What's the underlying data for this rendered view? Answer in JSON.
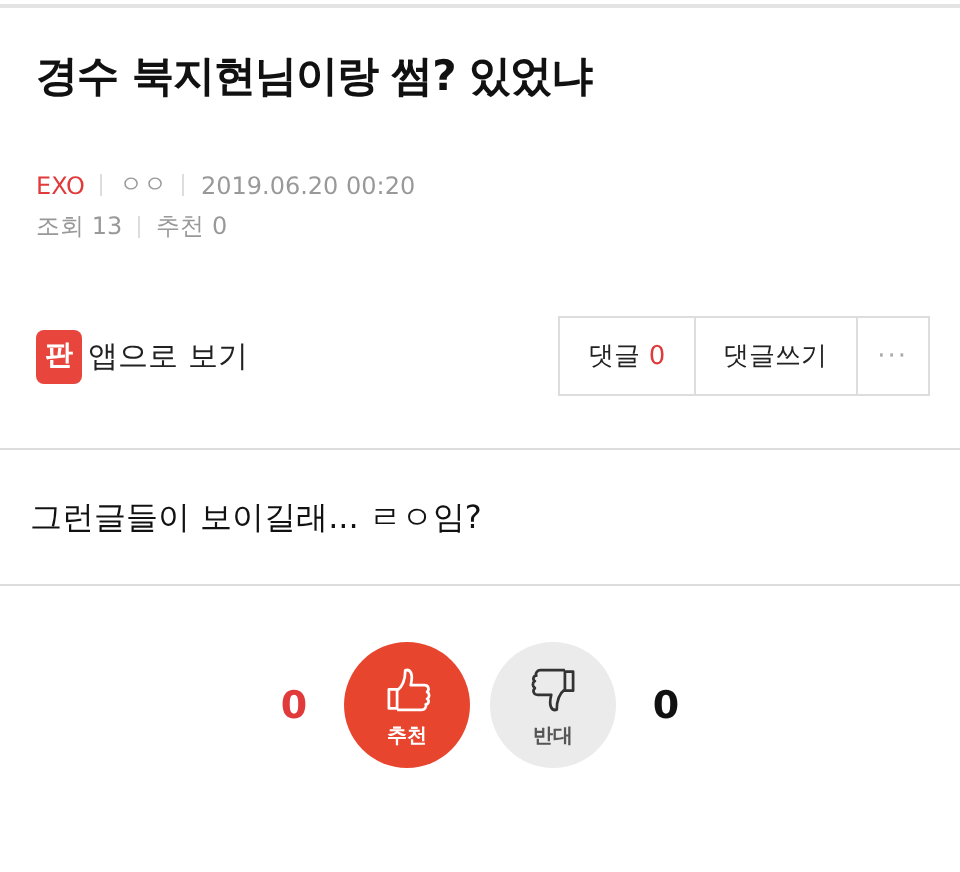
{
  "post": {
    "title": "경수 북지현님이랑 썸? 있었냐",
    "meta": [
      {
        "kind": "category",
        "text": "EXO"
      },
      {
        "kind": "author",
        "text": "ㅇㅇ"
      },
      {
        "kind": "date",
        "text": "2019.06.20 00:20"
      }
    ],
    "stats": [
      {
        "label": "조회",
        "value": "13"
      },
      {
        "label": "추천",
        "value": "0"
      }
    ]
  },
  "app_link": {
    "icon_text": "판",
    "label": "앱으로 보기"
  },
  "actions": [
    {
      "kind": "comments",
      "label": "댓글",
      "count": "0"
    },
    {
      "kind": "write",
      "label": "댓글쓰기"
    },
    {
      "kind": "more",
      "label": "···"
    }
  ],
  "body": "그런글들이 보이길래... ㄹㅇ임?",
  "votes": [
    {
      "kind": "up",
      "label": "추천",
      "count": "0"
    },
    {
      "kind": "down",
      "label": "반대",
      "count": "0"
    }
  ]
}
